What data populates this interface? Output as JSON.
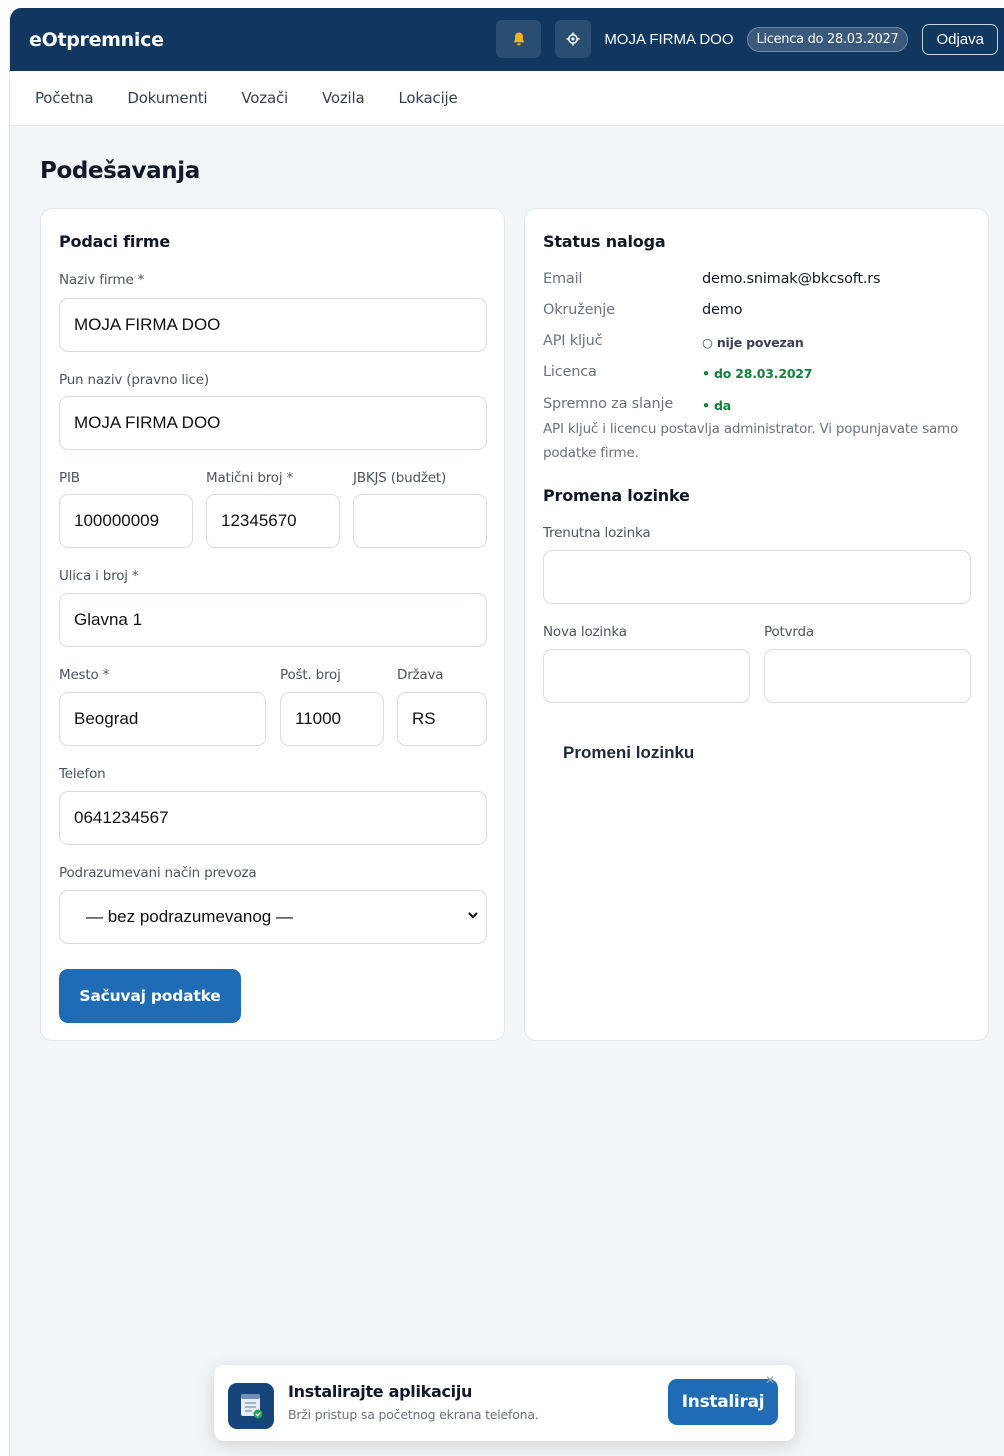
{
  "app": {
    "brand": "eOtpremnice",
    "company": "MOJA FIRMA DOO",
    "licence_badge": "Licenca do 28.03.2027",
    "logout_label": "Odjava"
  },
  "nav": {
    "items": [
      "Početna",
      "Dokumenti",
      "Vozači",
      "Vozila",
      "Lokacije"
    ]
  },
  "page": {
    "title": "Podešavanja"
  },
  "company_form": {
    "title": "Podaci firme",
    "name_label": "Naziv firme *",
    "name_value": "MOJA FIRMA DOO",
    "full_name_label": "Pun naziv (pravno lice)",
    "full_name_value": "MOJA FIRMA DOO",
    "pib_label": "PIB",
    "pib_value": "100000009",
    "mb_label": "Matični broj *",
    "mb_value": "12345670",
    "jbkjs_label": "JBKJS (budžet)",
    "jbkjs_value": "",
    "street_label": "Ulica i broj *",
    "street_value": "Glavna 1",
    "city_label": "Mesto *",
    "city_value": "Beograd",
    "zip_label": "Pošt. broj",
    "zip_value": "11000",
    "country_label": "Država",
    "country_value": "RS",
    "phone_label": "Telefon",
    "phone_value": "0641234567",
    "transport_label": "Podrazumevani način prevoza",
    "transport_value": "— bez podrazumevanog —",
    "save_label": "Sačuvaj podatke"
  },
  "status": {
    "title": "Status naloga",
    "email_key": "Email",
    "email_value": "demo.snimak@bkcsoft.rs",
    "env_key": "Okruženje",
    "env_value": "demo",
    "api_key": "API ključ",
    "api_value": "○ nije povezan",
    "licence_key": "Licenca",
    "licence_value": "• do 28.03.2027",
    "ready_key": "Spremno za slanje",
    "ready_value": "• da",
    "note": "API ključ i licencu postavlja administrator. Vi popunjavate samo podatke firme."
  },
  "password": {
    "title": "Promena lozinke",
    "current_label": "Trenutna lozinka",
    "new_label": "Nova lozinka",
    "confirm_label": "Potvrda",
    "change_label": "Promeni lozinku"
  },
  "install": {
    "title": "Instalirajte aplikaciju",
    "subtitle": "Brži pristup sa početnog ekrana telefona.",
    "button": "Instaliraj",
    "close": "✕"
  },
  "icons": {
    "bell": "bell-icon",
    "gear": "gear-icon",
    "chevron": "chevron-down-icon",
    "app": "app-document-icon"
  },
  "colors": {
    "header": "#10375f",
    "primary": "#1f6cb4",
    "success": "#15803d",
    "bell": "#f5b316"
  }
}
